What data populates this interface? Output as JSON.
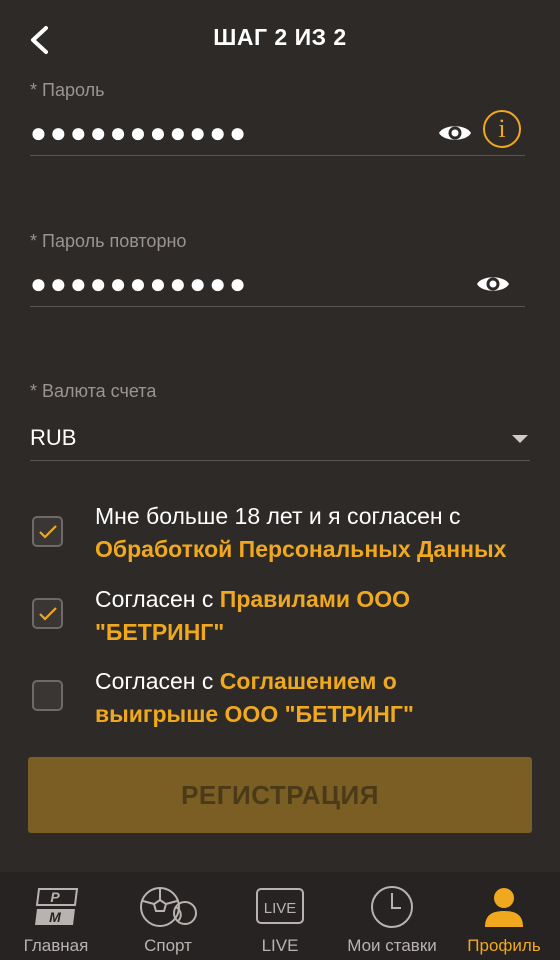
{
  "header": {
    "title": "ШАГ 2 ИЗ 2"
  },
  "password": {
    "label": "* Пароль",
    "value": "●●●●●●●●●●●"
  },
  "password_repeat": {
    "label": "* Пароль повторно",
    "value": "●●●●●●●●●●●"
  },
  "currency": {
    "label": "* Валюта счета",
    "value": "RUB"
  },
  "agreements": [
    {
      "checked": true,
      "text": "Мне больше 18 лет и я согласен с ",
      "link": "Обработкой Персональных Данных"
    },
    {
      "checked": true,
      "text": "Согласен с ",
      "link": "Правилами ООО \"БЕТРИНГ\""
    },
    {
      "checked": false,
      "text": "Согласен с ",
      "link": "Соглашением о выигрыше ООО \"БЕТРИНГ\""
    }
  ],
  "register_button": "РЕГИСТРАЦИЯ",
  "tabbar": {
    "items": [
      {
        "label": "Главная",
        "icon": "pm-logo-icon"
      },
      {
        "label": "Спорт",
        "icon": "sport-balls-icon"
      },
      {
        "label": "LIVE",
        "icon": "live-icon",
        "badge": "LIVE"
      },
      {
        "label": "Мои ставки",
        "icon": "clock-icon"
      },
      {
        "label": "Профиль",
        "icon": "profile-icon",
        "active": true
      }
    ]
  },
  "colors": {
    "accent": "#f0a91e",
    "background": "#2d2a28",
    "button_disabled": "#7a5e24"
  }
}
